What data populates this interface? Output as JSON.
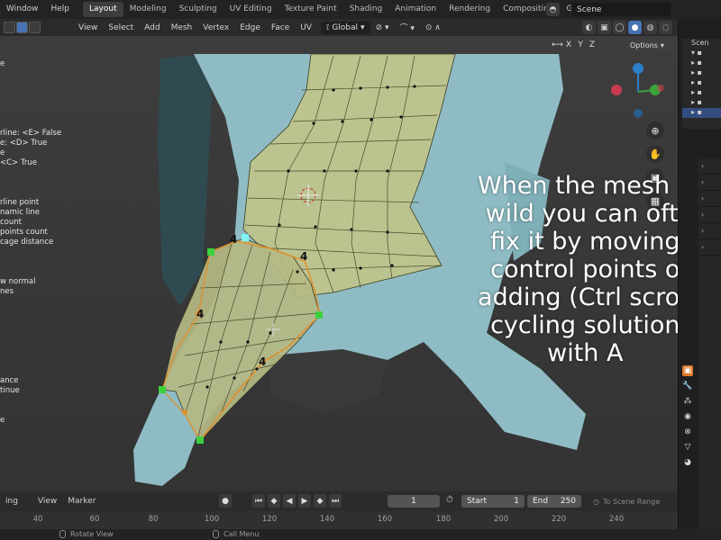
{
  "topbar": {
    "menus": [
      "Window",
      "Help"
    ],
    "workspaces": [
      "Layout",
      "Modeling",
      "Sculpting",
      "UV Editing",
      "Texture Paint",
      "Shading",
      "Animation",
      "Rendering",
      "Compositing",
      "G"
    ],
    "active_workspace": "Layout",
    "scene_name": "Scene"
  },
  "viewport_header": {
    "menus": [
      "View",
      "Select",
      "Add",
      "Mesh",
      "Vertex",
      "Edge",
      "Face",
      "UV"
    ],
    "transform_orientation": "Global",
    "axes": [
      "X",
      "Y",
      "Z"
    ],
    "options_label": "Options"
  },
  "left_panel": {
    "lines": [
      "e",
      "",
      "",
      "",
      "",
      "",
      "",
      "rline: <E> False",
      "e: <D> True",
      "e",
      "<C> True",
      "",
      "",
      "",
      "rline point",
      "namic line",
      "count",
      " points count",
      "cage distance",
      "",
      "",
      "",
      "w normal",
      "nes",
      "",
      "",
      "",
      "",
      "",
      "",
      "",
      "",
      "ance",
      "tinue",
      "",
      "",
      "e"
    ]
  },
  "caption": {
    "text": "When the mesh g\n wild you can ofte\n fix it by moving\n control points o\nadding (Ctrl scroll\n cycling solution\n with A"
  },
  "mesh_labels": [
    "4",
    "4",
    "4",
    "4"
  ],
  "timeline": {
    "menus": [
      "ing",
      "View",
      "Marker"
    ],
    "current_frame": "1",
    "start_label": "Start",
    "start_value": "1",
    "end_label": "End",
    "end_value": "250",
    "to_scene_range": "To Scene Range",
    "ruler_ticks": [
      "40",
      "60",
      "80",
      "100",
      "120",
      "140",
      "160",
      "180",
      "200",
      "220",
      "240"
    ]
  },
  "statusbar": {
    "items": [
      "Rotate View",
      "Call Menu"
    ]
  },
  "outliner": {
    "rows": [
      "Scen",
      "",
      "",
      "",
      "",
      "",
      "",
      ""
    ]
  },
  "colors": {
    "mesh_fill": "#c0c48a",
    "surface": "#8fbcc4",
    "accent": "#4772b3",
    "active_tab": "#e07b2b"
  }
}
